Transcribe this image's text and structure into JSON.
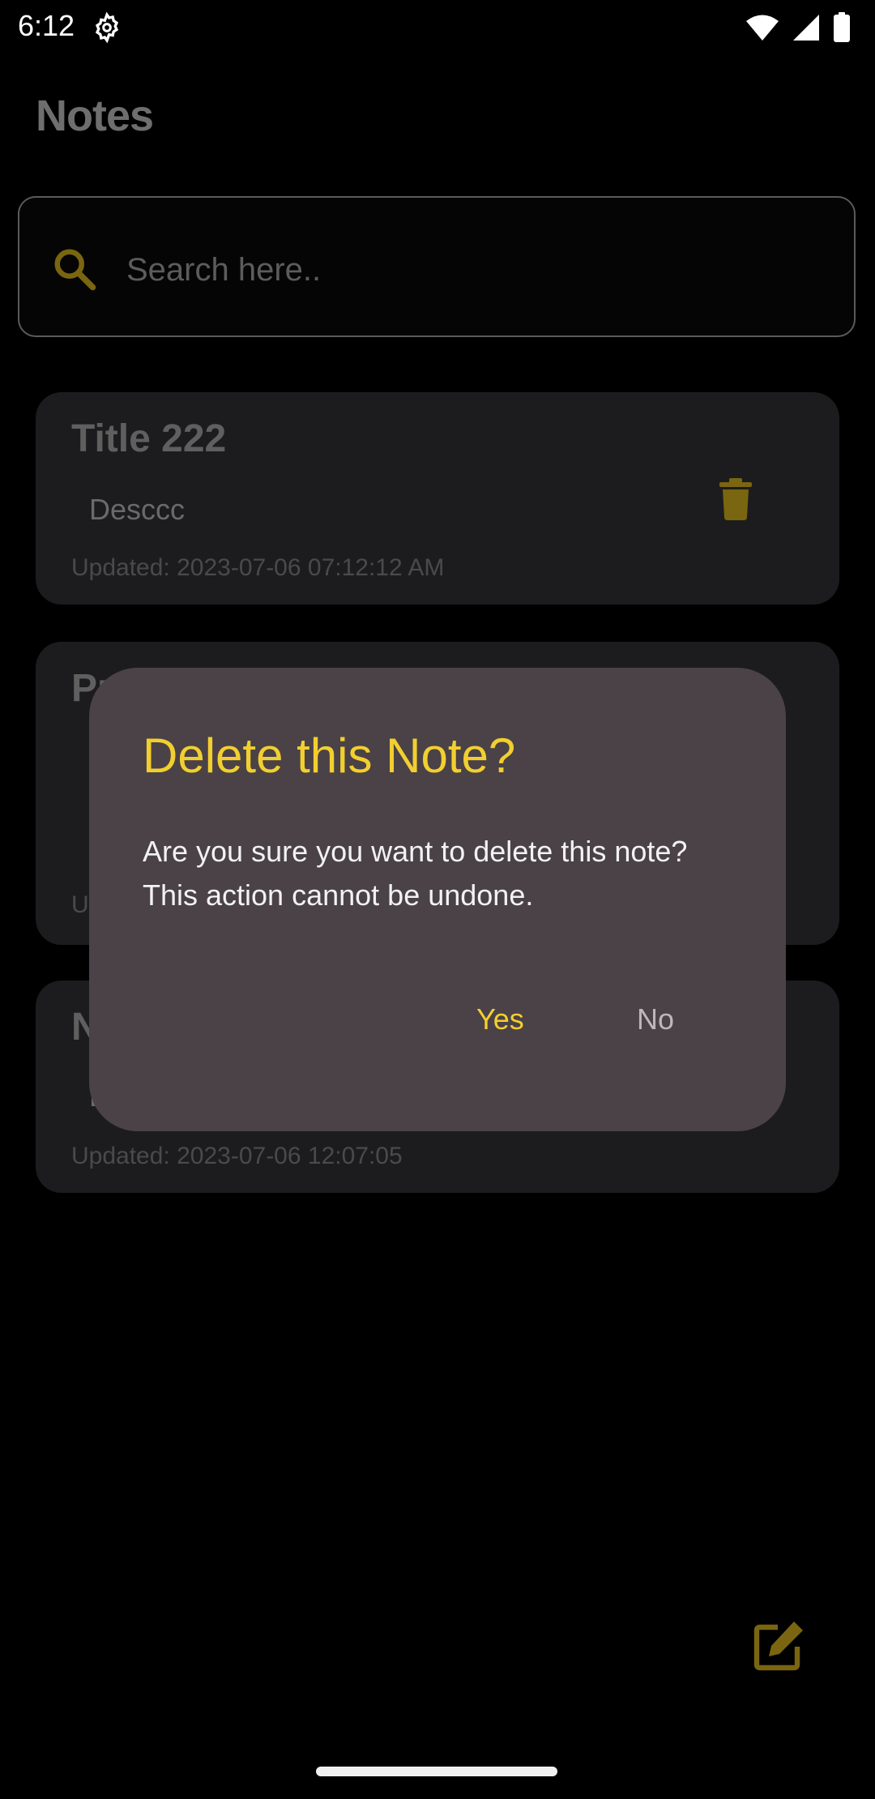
{
  "status_bar": {
    "time": "6:12",
    "icons": [
      "gear-icon",
      "wifi-icon",
      "signal-icon",
      "battery-icon"
    ]
  },
  "app": {
    "title": "Notes"
  },
  "search": {
    "placeholder": "Search here.."
  },
  "notes": [
    {
      "title": "Title 222",
      "description": "Desccc",
      "updated": "Updated: 2023-07-06 07:12:12 AM"
    },
    {
      "title": "Pr",
      "description": "",
      "updated": "U"
    },
    {
      "title": "N",
      "description": "D",
      "updated": "Updated: 2023-07-06 12:07:05"
    }
  ],
  "dialog": {
    "title": "Delete this Note?",
    "message": "Are you sure you want to delete this note? This action cannot be undone.",
    "yes_label": "Yes",
    "no_label": "No"
  },
  "colors": {
    "accent": "#f2cf2f",
    "dialog_bg": "#4a4246",
    "card_bg": "#1c1c1e",
    "icon_muted": "#7a6510"
  }
}
